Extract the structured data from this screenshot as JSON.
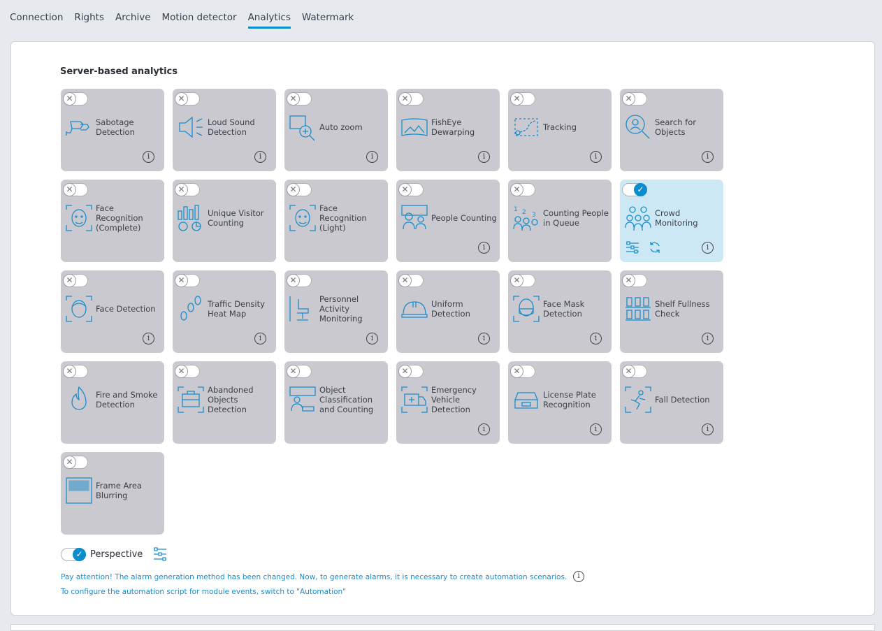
{
  "tabs": [
    {
      "label": "Connection"
    },
    {
      "label": "Rights"
    },
    {
      "label": "Archive"
    },
    {
      "label": "Motion detector"
    },
    {
      "label": "Analytics",
      "active": true
    },
    {
      "label": "Watermark"
    }
  ],
  "section_title": "Server-based analytics",
  "accent_color": "#0a8ccd",
  "modules": [
    {
      "label": "Sabotage Detection",
      "icon": "sabotage-camera-icon",
      "enabled": false,
      "info": true
    },
    {
      "label": "Loud Sound Detection",
      "icon": "loud-sound-icon",
      "enabled": false,
      "info": true
    },
    {
      "label": "Auto zoom",
      "icon": "auto-zoom-icon",
      "enabled": false,
      "info": true
    },
    {
      "label": "FishEye Dewarping",
      "icon": "fisheye-icon",
      "enabled": false,
      "info": true
    },
    {
      "label": "Tracking",
      "icon": "tracking-icon",
      "enabled": false,
      "info": true
    },
    {
      "label": "Search for Objects",
      "icon": "search-objects-icon",
      "enabled": false,
      "info": true
    },
    {
      "label": "Face Recognition (Complete)",
      "icon": "face-recognition-icon",
      "enabled": false,
      "info": false
    },
    {
      "label": "Unique Visitor Counting",
      "icon": "unique-visitor-icon",
      "enabled": false,
      "info": false
    },
    {
      "label": "Face Recognition (Light)",
      "icon": "face-recognition-light-icon",
      "enabled": false,
      "info": false
    },
    {
      "label": "People Counting",
      "icon": "people-counting-icon",
      "enabled": false,
      "info": true
    },
    {
      "label": "Counting People in Queue",
      "icon": "queue-counting-icon",
      "enabled": false,
      "info": false
    },
    {
      "label": "Crowd Monitoring",
      "icon": "crowd-icon",
      "enabled": true,
      "info": true
    },
    {
      "label": "Face Detection",
      "icon": "face-detection-icon",
      "enabled": false,
      "info": true
    },
    {
      "label": "Traffic Density Heat Map",
      "icon": "footprints-icon",
      "enabled": false,
      "info": true
    },
    {
      "label": "Personnel Activity Monitoring",
      "icon": "office-chair-icon",
      "enabled": false,
      "info": true
    },
    {
      "label": "Uniform Detection",
      "icon": "hard-hat-icon",
      "enabled": false,
      "info": true
    },
    {
      "label": "Face Mask Detection",
      "icon": "face-mask-icon",
      "enabled": false,
      "info": true
    },
    {
      "label": "Shelf Fullness Check",
      "icon": "shelf-icon",
      "enabled": false,
      "info": true
    },
    {
      "label": "Fire and Smoke Detection",
      "icon": "fire-icon",
      "enabled": false,
      "info": false
    },
    {
      "label": "Abandoned Objects Detection",
      "icon": "suitcase-icon",
      "enabled": false,
      "info": false
    },
    {
      "label": "Object Classification and Counting",
      "icon": "object-classification-icon",
      "enabled": false,
      "info": false
    },
    {
      "label": "Emergency Vehicle Detection",
      "icon": "ambulance-icon",
      "enabled": false,
      "info": true
    },
    {
      "label": "License Plate Recognition",
      "icon": "car-plate-icon",
      "enabled": false,
      "info": true
    },
    {
      "label": "Fall Detection",
      "icon": "fall-icon",
      "enabled": false,
      "info": true
    },
    {
      "label": "Frame Area Blurring",
      "icon": "blur-icon",
      "enabled": false,
      "info": false
    }
  ],
  "perspective": {
    "label": "Perspective",
    "enabled": true
  },
  "notes": [
    "Pay attention! The alarm generation method has been changed. Now, to generate alarms, it is necessary to create automation scenarios.",
    "To configure the automation script for module events, switch to \"Automation\""
  ]
}
